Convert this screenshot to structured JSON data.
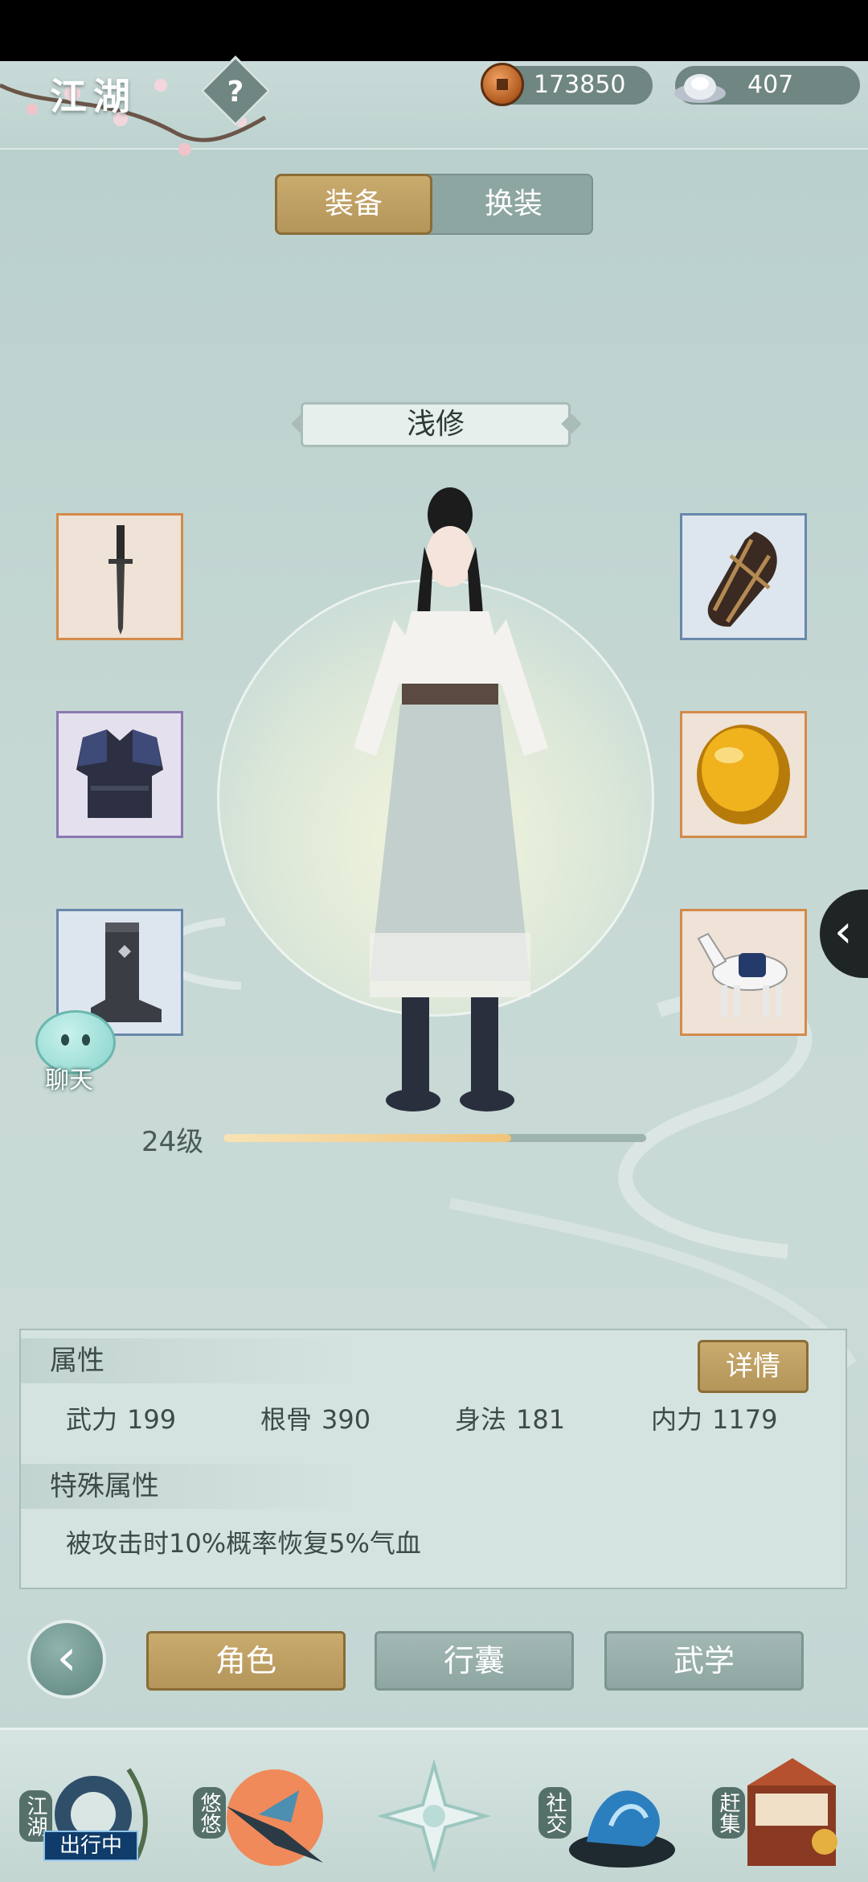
{
  "header": {
    "title": "江湖",
    "copper": "173850",
    "silver": "407"
  },
  "tabs": {
    "equip": "装备",
    "wardrobe": "换装"
  },
  "character": {
    "name": "浅修",
    "level": "24级",
    "xp_progress": 0.68
  },
  "equipment_slots": [
    {
      "slot": "weapon",
      "icon": "dagger-icon",
      "rarity": "orange"
    },
    {
      "slot": "armor",
      "icon": "armor-icon",
      "rarity": "purple"
    },
    {
      "slot": "boots",
      "icon": "boots-icon",
      "rarity": "blue"
    },
    {
      "slot": "bracer",
      "icon": "bracer-icon",
      "rarity": "blue"
    },
    {
      "slot": "accessory",
      "icon": "amber-gem-icon",
      "rarity": "orange"
    },
    {
      "slot": "mount",
      "icon": "horse-icon",
      "rarity": "orange"
    }
  ],
  "chat": {
    "label": "聊天"
  },
  "attributes": {
    "heading": "属性",
    "detail_button": "详情",
    "stats": [
      {
        "name": "武力",
        "value": "199"
      },
      {
        "name": "根骨",
        "value": "390"
      },
      {
        "name": "身法",
        "value": "181"
      },
      {
        "name": "内力",
        "value": "1179"
      }
    ]
  },
  "special": {
    "heading": "特殊属性",
    "text": "被攻击时10%概率恢复5%气血"
  },
  "nav": {
    "role": "角色",
    "bag": "行囊",
    "martial": "武学"
  },
  "dock": {
    "jianghu": "江湖",
    "travel_badge": "出行中",
    "youyou": "悠悠",
    "social": "社交",
    "market": "赶集"
  },
  "colors": {
    "gold_button": "#c9ab6e",
    "teal_button": "#8ea6a2",
    "background": "#c4d6d2"
  }
}
